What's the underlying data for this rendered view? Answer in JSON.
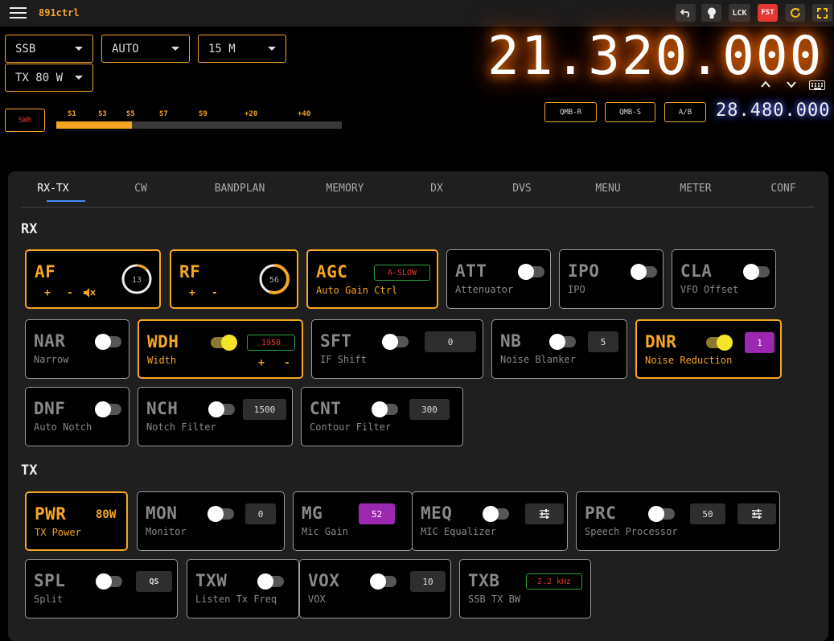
{
  "app": {
    "title": "891ctrl"
  },
  "toolbar": {
    "undo_icon": "undo-icon",
    "bulb_icon": "lightbulb-icon",
    "lock_label": "LCK",
    "fast_label": "FST",
    "refresh_icon": "refresh-icon",
    "fullscreen_icon": "fullscreen-icon"
  },
  "controls": {
    "mode": "SSB",
    "agc": "AUTO",
    "band": "15 M",
    "tx_power": "TX 80 W"
  },
  "meter": {
    "swr_label": "SWR",
    "scale": [
      "S1",
      "S3",
      "S5",
      "S7",
      "S9",
      "+20",
      "+40"
    ],
    "level_fraction": 0.265
  },
  "vfo": {
    "main": "21.320.000",
    "sub": "28.480.000",
    "qmb_r": "QMB-R",
    "qmb_s": "QMB-S",
    "ab": "A/B"
  },
  "tabs": [
    "RX-TX",
    "CW",
    "BANDPLAN",
    "MEMORY",
    "DX",
    "DVS",
    "MENU",
    "METER",
    "CONF"
  ],
  "active_tab": "RX-TX",
  "rx": {
    "title": "RX",
    "af": {
      "abbr": "AF",
      "plus": "+",
      "minus": "-",
      "value": "13",
      "level": 0.13
    },
    "rf": {
      "abbr": "RF",
      "plus": "+",
      "minus": "-",
      "value": "56",
      "level": 0.56
    },
    "agc": {
      "abbr": "AGC",
      "desc": "Auto Gain Ctrl",
      "value": "A-SLOW"
    },
    "att": {
      "abbr": "ATT",
      "desc": "Attenuator",
      "on": false
    },
    "ipo": {
      "abbr": "IPO",
      "desc": "IPO",
      "on": false
    },
    "cla": {
      "abbr": "CLA",
      "desc": "VFO Offset",
      "on": false
    },
    "nar": {
      "abbr": "NAR",
      "desc": "Narrow",
      "on": false
    },
    "wdh": {
      "abbr": "WDH",
      "desc": "Width",
      "on": true,
      "value": "1950",
      "plus": "+",
      "minus": "-"
    },
    "sft": {
      "abbr": "SFT",
      "desc": "IF Shift",
      "on": false,
      "value": "0"
    },
    "nb": {
      "abbr": "NB",
      "desc": "Noise Blanker",
      "on": false,
      "value": "5"
    },
    "dnr": {
      "abbr": "DNR",
      "desc": "Noise Reduction",
      "on": true,
      "value": "1"
    },
    "dnf": {
      "abbr": "DNF",
      "desc": "Auto Notch",
      "on": false
    },
    "nch": {
      "abbr": "NCH",
      "desc": "Notch Filter",
      "on": false,
      "value": "1500"
    },
    "cnt": {
      "abbr": "CNT",
      "desc": "Contour Filter",
      "on": false,
      "value": "300"
    }
  },
  "tx": {
    "title": "TX",
    "pwr": {
      "abbr": "PWR",
      "desc": "TX Power",
      "value": "80W"
    },
    "mon": {
      "abbr": "MON",
      "desc": "Monitor",
      "on": false,
      "value": "0"
    },
    "mg": {
      "abbr": "MG",
      "desc": "Mic Gain",
      "value": "52"
    },
    "meq": {
      "abbr": "MEQ",
      "desc": "MIC Equalizer",
      "on": false
    },
    "prc": {
      "abbr": "PRC",
      "desc": "Speech Processor",
      "on": false,
      "value": "50"
    },
    "spl": {
      "abbr": "SPL",
      "desc": "Split",
      "on": false,
      "value": "QS"
    },
    "txw": {
      "abbr": "TXW",
      "desc": "Listen Tx Freq",
      "on": false
    },
    "vox": {
      "abbr": "VOX",
      "desc": "VOX",
      "on": false,
      "value": "10"
    },
    "txb": {
      "abbr": "TXB",
      "desc": "SSB TX BW",
      "value": "2.2 kHz"
    }
  },
  "colors": {
    "accent": "#f5a623",
    "toggle_on": "#f5e52a",
    "purple": "#9c27b0",
    "tab_underline": "#3d8bff"
  }
}
